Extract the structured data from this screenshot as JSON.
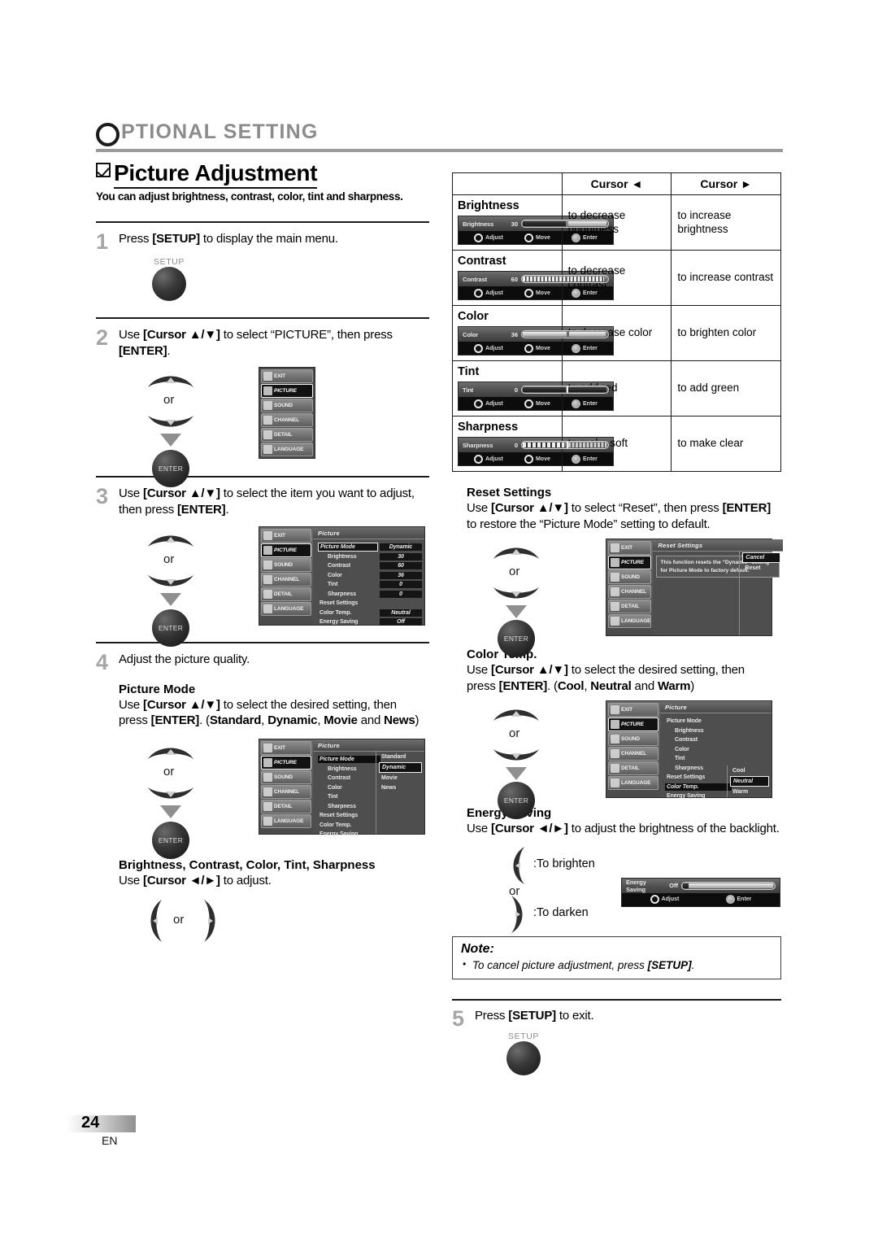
{
  "chapter": {
    "initial": "O",
    "title": "PTIONAL  SETTING"
  },
  "title": {
    "heading": "Picture Adjustment",
    "subtitle": "You can adjust brightness, contrast, color, tint and sharpness."
  },
  "steps": {
    "s1": {
      "num": "1",
      "text_a": "Press ",
      "text_b": "[SETUP]",
      "text_c": " to display the main menu.",
      "button": "SETUP"
    },
    "s2": {
      "num": "2",
      "line1_a": "Use ",
      "line1_b": "[Cursor ▲/▼]",
      "line1_c": " to select “PICTURE”, then press",
      "line2_b": "[ENTER]",
      "line2_c": ".",
      "or": "or",
      "enter": "ENTER"
    },
    "s3": {
      "num": "3",
      "line1_a": "Use ",
      "line1_b": "[Cursor ▲/▼]",
      "line1_c": " to select the item you want to adjust,",
      "line2_a": "then press ",
      "line2_b": "[ENTER]",
      "line2_c": ".",
      "or": "or",
      "enter": "ENTER"
    },
    "s4": {
      "num": "4",
      "text": "Adjust the picture quality."
    },
    "s5": {
      "num": "5",
      "text_a": "Press ",
      "text_b": "[SETUP]",
      "text_c": " to exit.",
      "button": "SETUP"
    }
  },
  "picture_mode": {
    "heading": "Picture Mode",
    "line1_a": "Use ",
    "line1_b": "[Cursor ▲/▼]",
    "line1_c": " to select the desired setting, then",
    "line2_a": "press ",
    "line2_b": "[ENTER]",
    "line2_c": ". (",
    "opt1": "Standard",
    "sep1": ", ",
    "opt2": "Dynamic",
    "sep2": ", ",
    "opt3": "Movie",
    "sep3": " and ",
    "opt4": "News",
    "close": ")",
    "or": "or",
    "enter": "ENTER"
  },
  "bcc": {
    "heading": "Brightness, Contrast, Color, Tint, Sharpness",
    "line_a": "Use ",
    "line_b": "[Cursor ◄/►]",
    "line_c": " to adjust.",
    "or": "or"
  },
  "table": {
    "headers": [
      "",
      "Cursor ◄",
      "Cursor ►"
    ],
    "rows": [
      {
        "item": "Brightness",
        "left": "to decrease brightness",
        "right": "to increase brightness",
        "bar": {
          "name": "Brightness",
          "value": "30",
          "style": "brightness"
        }
      },
      {
        "item": "Contrast",
        "left": "to decrease contrast",
        "right": "to increase contrast",
        "bar": {
          "name": "Contrast",
          "value": "60",
          "style": "contrast"
        }
      },
      {
        "item": "Color",
        "left": "to decrease color",
        "right": "to brighten color",
        "bar": {
          "name": "Color",
          "value": "36",
          "style": "color"
        }
      },
      {
        "item": "Tint",
        "left": "to add red",
        "right": "to add green",
        "bar": {
          "name": "Tint",
          "value": "0",
          "style": "tint"
        }
      },
      {
        "item": "Sharpness",
        "left": "to make soft",
        "right": "to make clear",
        "bar": {
          "name": "Sharpness",
          "value": "0",
          "style": "sharpness"
        }
      }
    ],
    "hints": {
      "adjust": "Adjust",
      "move": "Move",
      "enter": "Enter"
    }
  },
  "reset": {
    "heading": "Reset Settings",
    "line1_a": "Use ",
    "line1_b": "[Cursor ▲/▼]",
    "line1_c": " to select “Reset”, then press ",
    "line1_d": "[ENTER]",
    "line2": "to restore the “Picture Mode” setting to default.",
    "or": "or",
    "enter": "ENTER"
  },
  "color_temp": {
    "heading": "Color Temp.",
    "line1_a": "Use ",
    "line1_b": "[Cursor ▲/▼]",
    "line1_c": " to select the desired setting, then",
    "line2_a": "press ",
    "line2_b": "[ENTER]",
    "line2_c": ". (",
    "opt1": "Cool",
    "sep1": ", ",
    "opt2": "Neutral",
    "sep2": " and ",
    "opt3": "Warm",
    "close": ")",
    "or": "or",
    "enter": "ENTER"
  },
  "energy": {
    "heading": "Energy Saving",
    "line_a": "Use ",
    "line_b": "[Cursor ◄/►]",
    "line_c": " to adjust the brightness of the backlight.",
    "brighten": ":To brighten",
    "darken": ":To darken",
    "or": "or",
    "bar": {
      "name": "Energy Saving",
      "value": "Off"
    }
  },
  "note": {
    "title": "Note:",
    "item_a": "To cancel picture adjustment, press ",
    "item_b": "[SETUP]",
    "item_c": "."
  },
  "osd_menu_main": {
    "sidebar": [
      "EXIT",
      "PICTURE",
      "SOUND",
      "CHANNEL",
      "DETAIL",
      "LANGUAGE"
    ],
    "active": "PICTURE",
    "title": "Picture",
    "rows": [
      {
        "label": "Picture Mode",
        "value": "Dynamic",
        "indent": false,
        "selected": true
      },
      {
        "label": "Brightness",
        "value": "30",
        "indent": true
      },
      {
        "label": "Contrast",
        "value": "60",
        "indent": true
      },
      {
        "label": "Color",
        "value": "36",
        "indent": true
      },
      {
        "label": "Tint",
        "value": "0",
        "indent": true
      },
      {
        "label": "Sharpness",
        "value": "0",
        "indent": true
      },
      {
        "label": "Reset Settings",
        "value": "",
        "indent": false
      },
      {
        "label": "Color Temp.",
        "value": "Neutral",
        "indent": false
      },
      {
        "label": "Energy Saving",
        "value": "Off",
        "indent": false
      }
    ]
  },
  "osd_menu_picmode": {
    "title": "Picture",
    "rows": [
      {
        "label": "Picture Mode",
        "indent": false,
        "selected": true
      },
      {
        "label": "Brightness",
        "indent": true
      },
      {
        "label": "Contrast",
        "indent": true
      },
      {
        "label": "Color",
        "indent": true
      },
      {
        "label": "Tint",
        "indent": true
      },
      {
        "label": "Sharpness",
        "indent": true
      },
      {
        "label": "Reset Settings",
        "indent": false
      },
      {
        "label": "Color Temp.",
        "indent": false
      },
      {
        "label": "Energy Saving",
        "indent": false
      }
    ],
    "options": [
      {
        "label": "Standard",
        "selected": false
      },
      {
        "label": "Dynamic",
        "selected": true
      },
      {
        "label": "Movie",
        "selected": false
      },
      {
        "label": "News",
        "selected": false
      }
    ]
  },
  "osd_menu_reset": {
    "title": "Reset Settings",
    "message": "This function resets the “Dynamic” setting for Picture Mode to factory default.",
    "options": [
      {
        "label": "Cancel",
        "selected": true
      },
      {
        "label": "Reset",
        "selected": false
      }
    ]
  },
  "osd_menu_colortemp": {
    "title": "Picture",
    "rows": [
      {
        "label": "Picture Mode",
        "indent": false
      },
      {
        "label": "Brightness",
        "indent": true
      },
      {
        "label": "Contrast",
        "indent": true
      },
      {
        "label": "Color",
        "indent": true
      },
      {
        "label": "Tint",
        "indent": true
      },
      {
        "label": "Sharpness",
        "indent": true
      },
      {
        "label": "Reset Settings",
        "indent": false
      },
      {
        "label": "Color Temp.",
        "indent": false,
        "selected": true
      },
      {
        "label": "Energy Saving",
        "indent": false
      }
    ],
    "options": [
      {
        "label": "Cool",
        "selected": false
      },
      {
        "label": "Neutral",
        "selected": true
      },
      {
        "label": "Warm",
        "selected": false
      }
    ]
  },
  "osd_sidebar_small": [
    "EXIT",
    "PICTURE",
    "SOUND",
    "CHANNEL",
    "DETAIL",
    "LANGUAGE"
  ],
  "footer": {
    "page": "24",
    "lang": "EN"
  }
}
